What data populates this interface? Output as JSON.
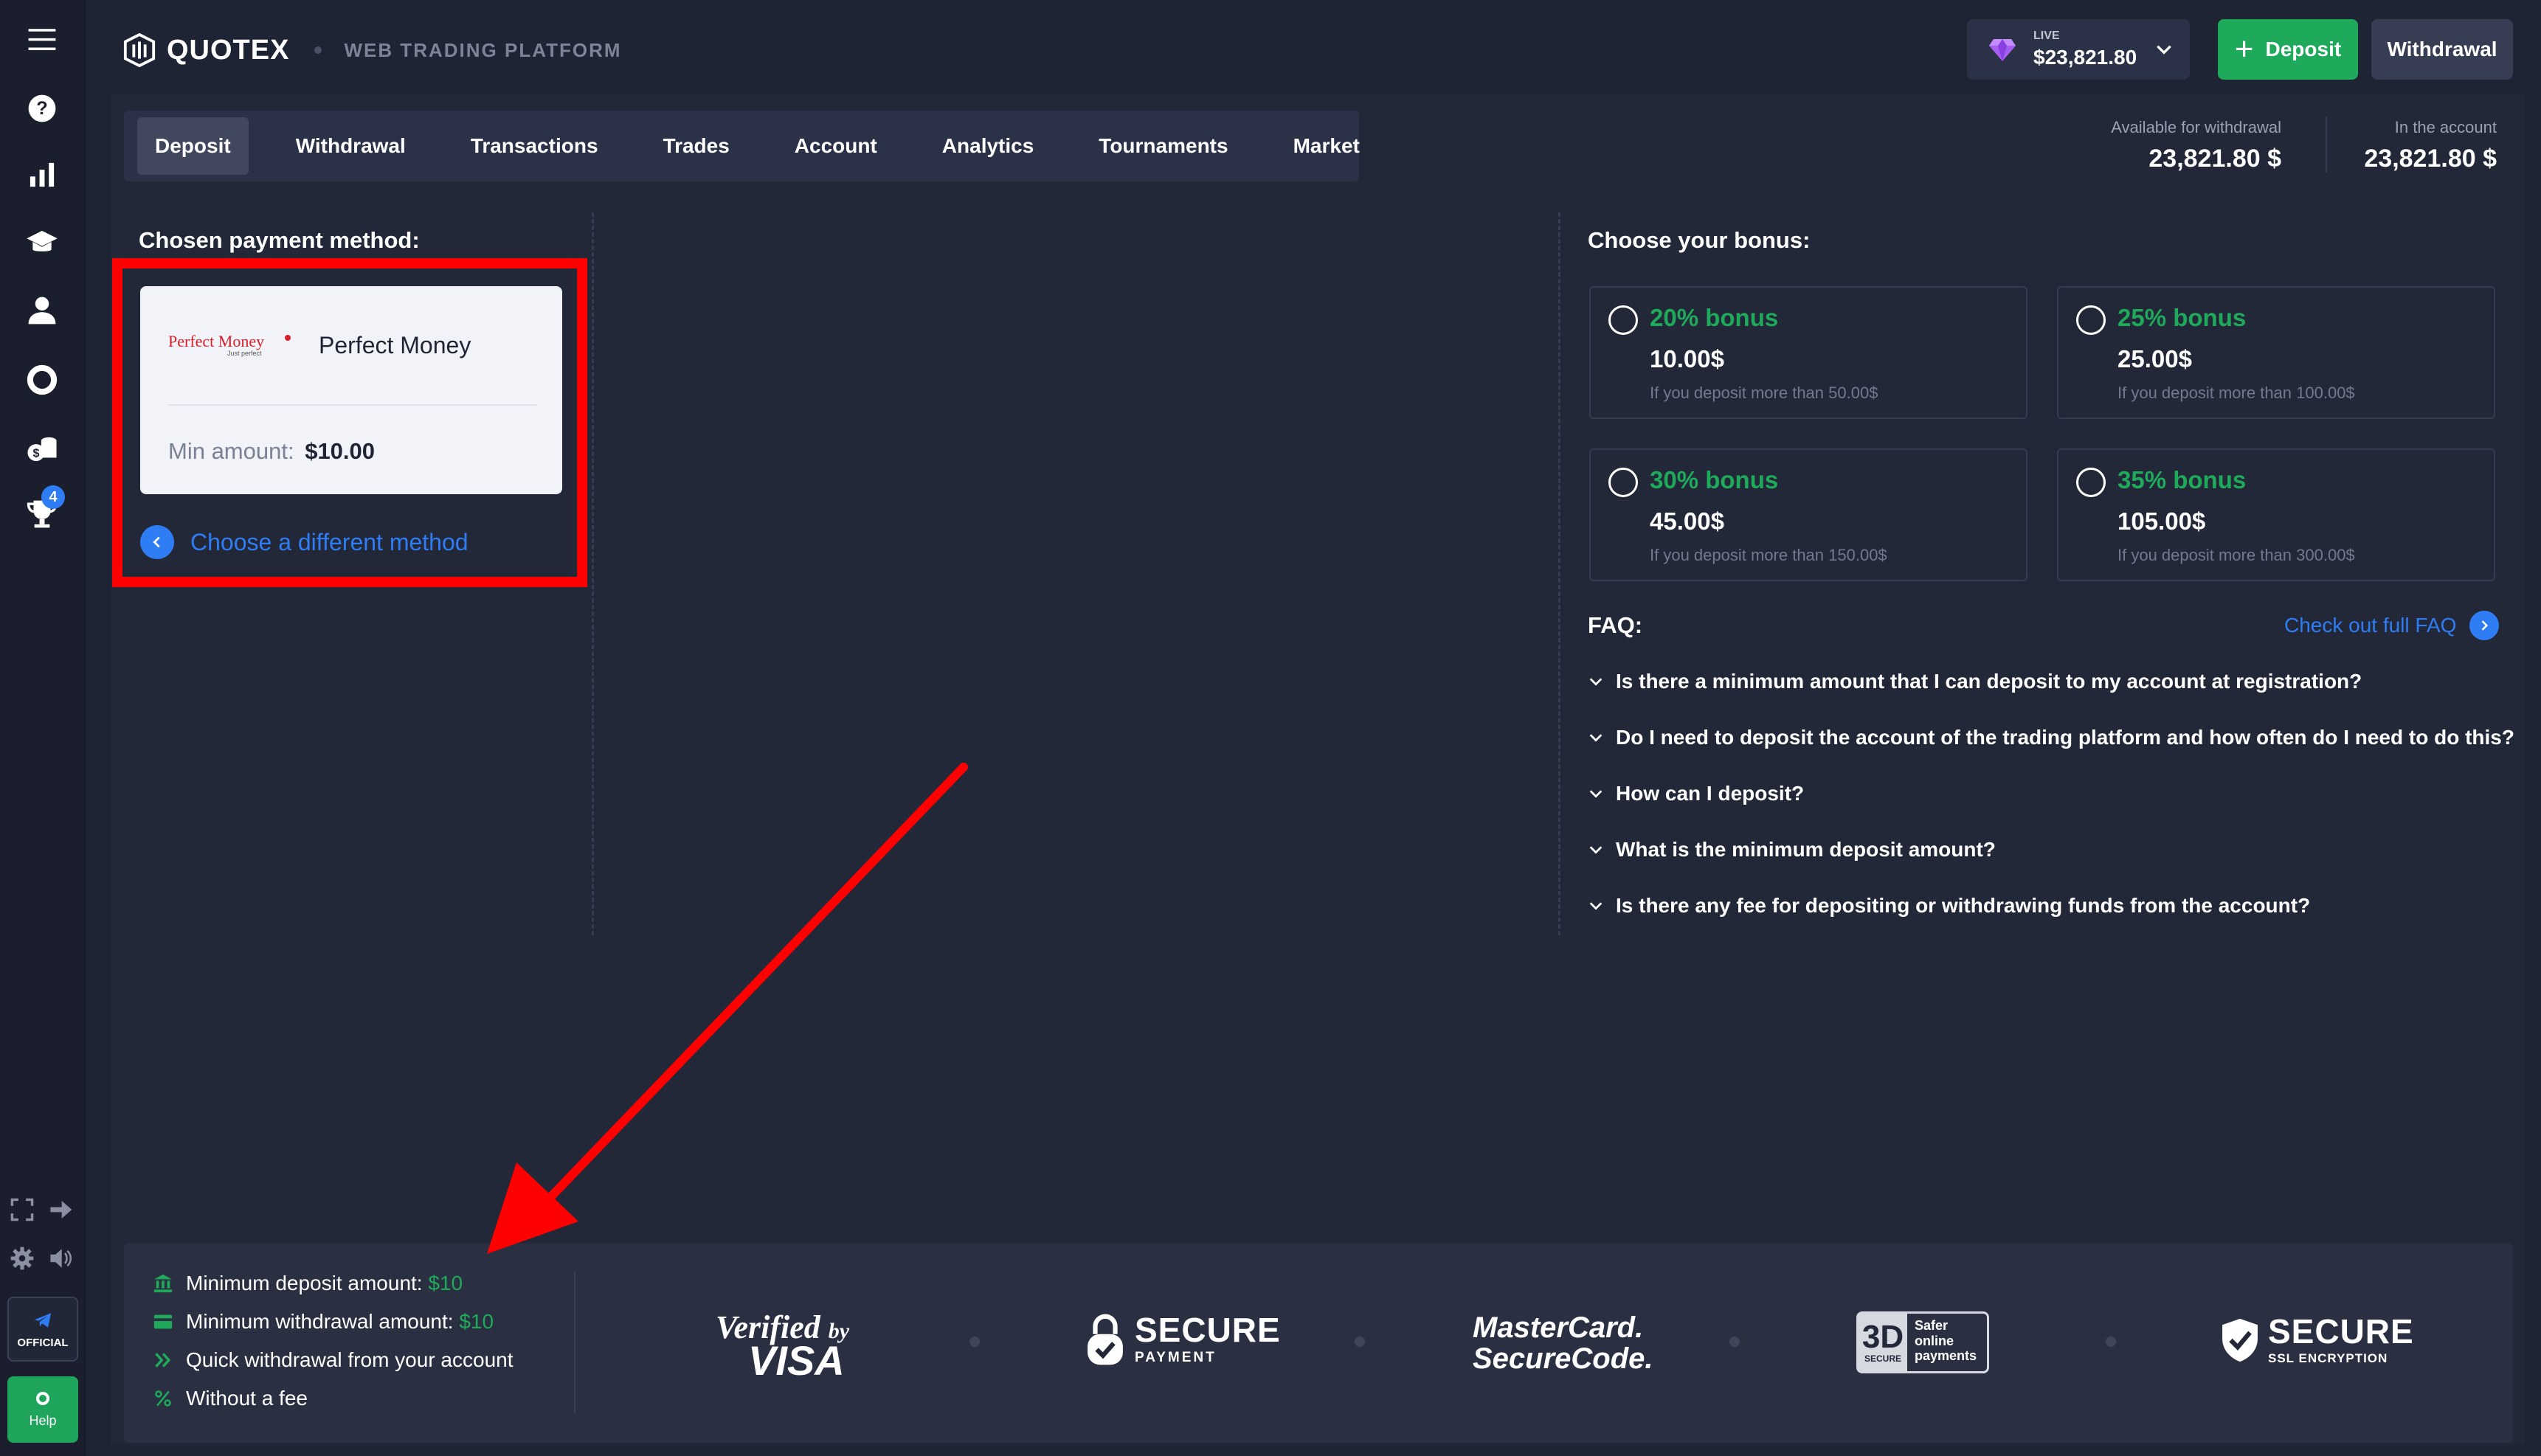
{
  "header": {
    "brand": "QUOTEX",
    "subtitle": "WEB TRADING PLATFORM",
    "account_type": "LIVE",
    "account_balance": "$23,821.80",
    "deposit_button": "Deposit",
    "withdrawal_button": "Withdrawal"
  },
  "sidebar": {
    "tournament_badge": "4",
    "official_label": "OFFICIAL",
    "help_label": "Help"
  },
  "tabs": [
    "Deposit",
    "Withdrawal",
    "Transactions",
    "Trades",
    "Account",
    "Analytics",
    "Tournaments",
    "Market"
  ],
  "balances": {
    "available_label": "Available for withdrawal",
    "available_value": "23,821.80 $",
    "account_label": "In the account",
    "account_value": "23,821.80 $"
  },
  "payment": {
    "title": "Chosen payment method:",
    "method_name": "Perfect Money",
    "logo_text": "Perfect Money",
    "logo_tagline": "Just perfect",
    "min_label": "Min amount:",
    "min_value": "$10.00",
    "change_link": "Choose a different method"
  },
  "bonus": {
    "title": "Choose your bonus:",
    "options": [
      {
        "percent": "20% bonus",
        "amount": "10.00$",
        "condition": "If you deposit more than 50.00$"
      },
      {
        "percent": "25% bonus",
        "amount": "25.00$",
        "condition": "If you deposit more than 100.00$"
      },
      {
        "percent": "30% bonus",
        "amount": "45.00$",
        "condition": "If you deposit more than 150.00$"
      },
      {
        "percent": "35% bonus",
        "amount": "105.00$",
        "condition": "If you deposit more than 300.00$"
      }
    ]
  },
  "faq": {
    "title": "FAQ:",
    "link": "Check out full FAQ",
    "items": [
      "Is there a minimum amount that I can deposit to my account at registration?",
      "Do I need to deposit the account of the trading platform and how often do I need to do this?",
      "How can I deposit?",
      "What is the minimum deposit amount?",
      "Is there any fee for depositing or withdrawing funds from the account?"
    ]
  },
  "bottom_info": {
    "min_deposit_label": "Minimum deposit amount:",
    "min_deposit_value": "$10",
    "min_withdrawal_label": "Minimum withdrawal amount:",
    "min_withdrawal_value": "$10",
    "quick_withdrawal": "Quick withdrawal from your account",
    "no_fee": "Without a fee"
  },
  "security_logos": {
    "verified_line1": "Verified",
    "verified_by": "by",
    "verified_line2": "VISA",
    "secure_payment_big": "SECURE",
    "secure_payment_small": "PAYMENT",
    "mastercard_line1": "MasterCard.",
    "mastercard_line2": "SecureCode.",
    "three_d": "3D",
    "three_d_secure": "SECURE",
    "three_d_line1": "Safer",
    "three_d_line2": "online",
    "three_d_line3": "payments",
    "secure_ssl_big": "SECURE",
    "secure_ssl_small": "SSL ENCRYPTION"
  },
  "colors": {
    "accent_green": "#1faa5b",
    "accent_blue": "#2f7df5",
    "highlight_red": "#ff0000",
    "background": "#1f2434"
  }
}
